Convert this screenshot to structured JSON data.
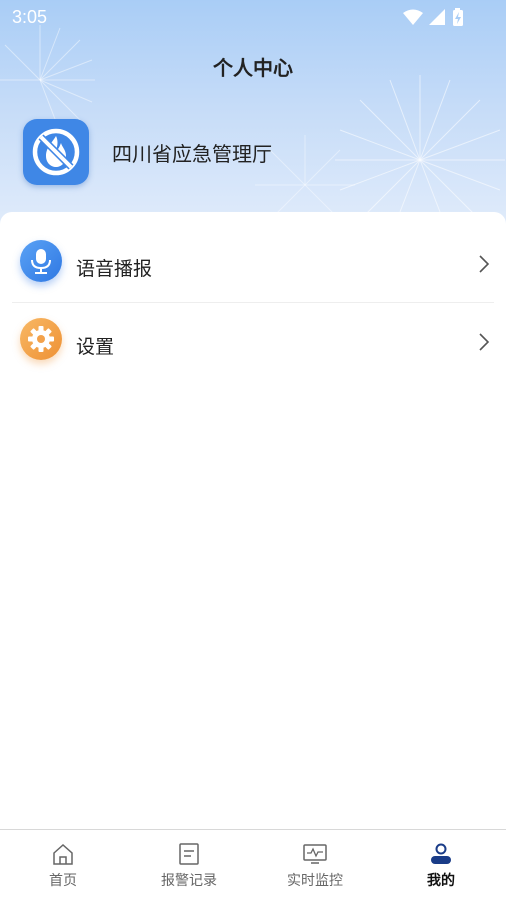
{
  "status_bar": {
    "time": "3:05"
  },
  "header": {
    "title": "个人中心"
  },
  "profile": {
    "org_name": "四川省应急管理厅"
  },
  "menu": [
    {
      "label": "语音播报",
      "icon": "microphone-icon",
      "color": "#3f86ec"
    },
    {
      "label": "设置",
      "icon": "gear-icon",
      "color": "#f3a24b"
    }
  ],
  "tabbar": {
    "tabs": [
      {
        "label": "首页",
        "icon": "home-icon",
        "active": false
      },
      {
        "label": "报警记录",
        "icon": "document-icon",
        "active": false
      },
      {
        "label": "实时监控",
        "icon": "monitor-icon",
        "active": false
      },
      {
        "label": "我的",
        "icon": "profile-icon",
        "active": true
      }
    ]
  },
  "colors": {
    "accent": "#3f87e6",
    "hero_top": "#a9cdf6",
    "settings_orange": "#f3a24b"
  }
}
